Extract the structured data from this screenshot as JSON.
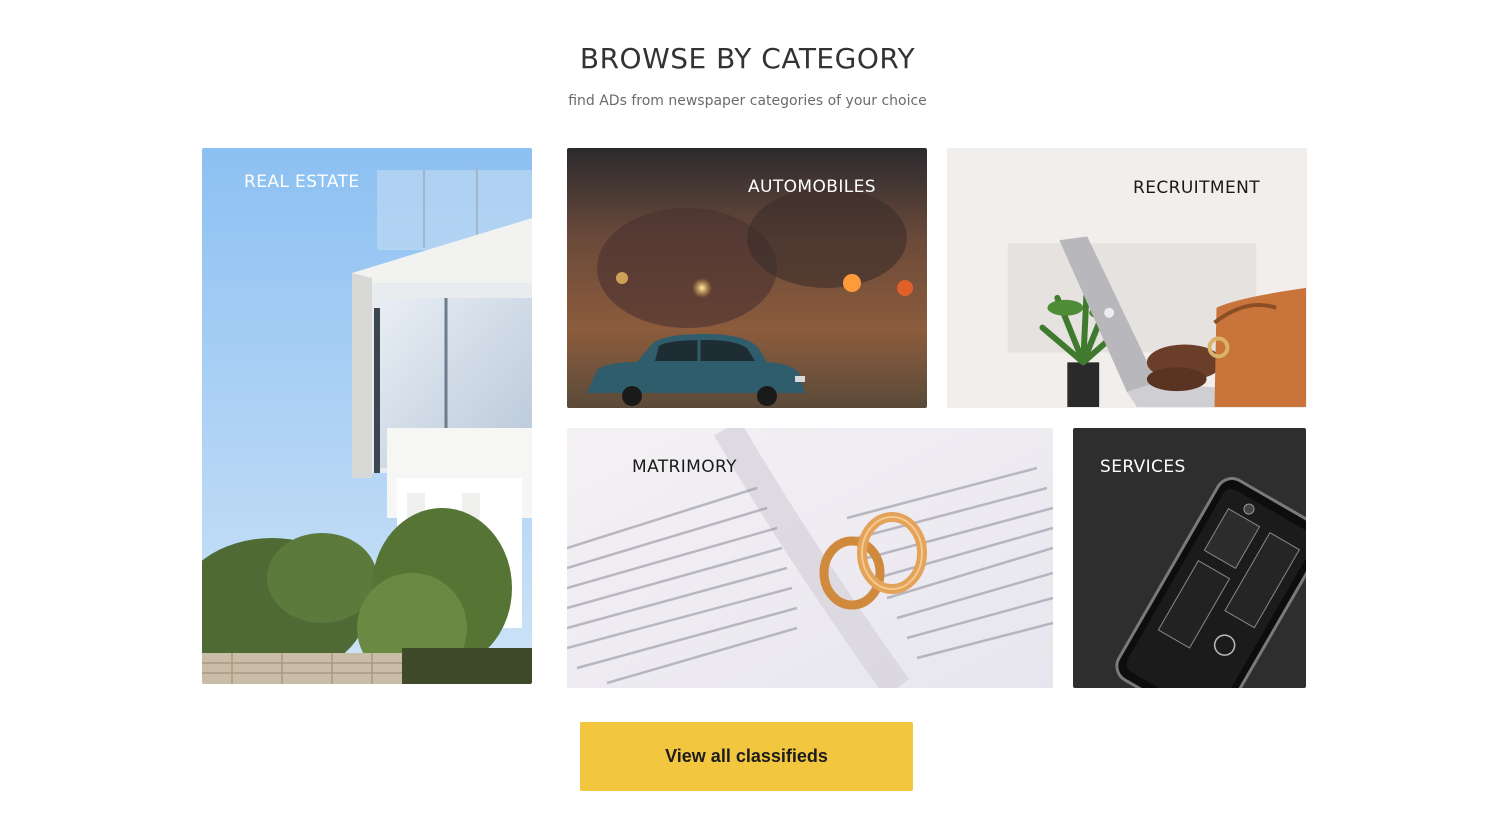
{
  "header": {
    "title": "BROWSE BY CATEGORY",
    "subtitle": "find ADs from newspaper categories of your choice"
  },
  "categories": [
    {
      "label": "REAL ESTATE",
      "image": "modern-house-photo"
    },
    {
      "label": "AUTOMOBILES",
      "image": "vintage-toy-car-photo"
    },
    {
      "label": "RECRUITMENT",
      "image": "laptop-typing-photo"
    },
    {
      "label": "MATRIMORY",
      "image": "wedding-rings-on-book-photo"
    },
    {
      "label": "SERVICES",
      "image": "smartphone-internals-photo"
    }
  ],
  "cta": {
    "label": "View all classifieds"
  },
  "colors": {
    "accent": "#f2c63f",
    "title": "#333333",
    "subtitle": "#6b6b6b"
  }
}
